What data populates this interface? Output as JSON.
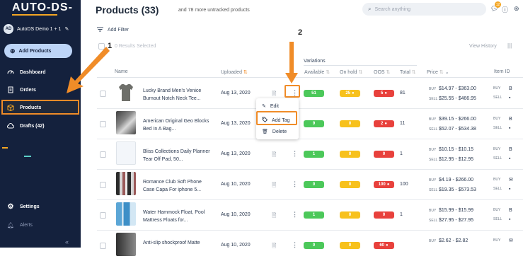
{
  "app": {
    "logo": "AUTO-DS-"
  },
  "sidebar": {
    "account_initials": "AD",
    "account_name": "AutoDS Demo 1 + 1",
    "add_products": "Add Products",
    "items": [
      {
        "label": "Dashboard",
        "icon": "speedometer-icon"
      },
      {
        "label": "Orders",
        "icon": "clipboard-icon"
      },
      {
        "label": "Products",
        "icon": "box-icon"
      },
      {
        "label": "Drafts (42)",
        "icon": "cloud-icon"
      },
      {
        "label": "Settings",
        "icon": "gear-icon"
      },
      {
        "label": "Alerts",
        "icon": "bell-icon"
      }
    ]
  },
  "header": {
    "title": "Products (33)",
    "subtitle": "and 78 more untracked products",
    "search_placeholder": "Search anything",
    "notification_count": "12"
  },
  "toolbar": {
    "add_filter": "Add Filter",
    "selected": "0 Results Selected",
    "view_history": "View History"
  },
  "table": {
    "group_label": "Variations",
    "headers": {
      "name": "Name",
      "uploaded": "Uploaded",
      "available": "Available",
      "on_hold": "On hold",
      "oos": "OOS",
      "total": "Total",
      "price": "Price",
      "item_id": "Item ID"
    },
    "rows": [
      {
        "name": "Lucky Brand Men's Venice Burnout Notch Neck Tee...",
        "date": "Aug 13, 2020",
        "available": "51",
        "on_hold": "25",
        "oos": "5",
        "total": "81",
        "buy": "$14.97 - $363.00",
        "sell": "$25.55 - $466.95",
        "buy_lbl": "BUY",
        "sell_lbl": "SELL",
        "id_icon1": "B",
        "id_icon2": "▪"
      },
      {
        "name": "American Original Geo Blocks Bed In A Bag...",
        "date": "Aug 13, 2020",
        "available": "9",
        "on_hold": "0",
        "oos": "2",
        "total": "11",
        "buy": "$39.15 - $266.00",
        "sell": "$52.07 - $534.38",
        "buy_lbl": "BUY",
        "sell_lbl": "SELL",
        "id_icon1": "B",
        "id_icon2": "▪"
      },
      {
        "name": "Bliss Collections Daily Planner Tear Off Pad, 50...",
        "date": "Aug 13, 2020",
        "available": "1",
        "on_hold": "0",
        "oos": "0",
        "total": "1",
        "buy": "$10.15 - $10.15",
        "sell": "$12.95 - $12.95",
        "buy_lbl": "BUY",
        "sell_lbl": "SELL",
        "id_icon1": "B",
        "id_icon2": "▪"
      },
      {
        "name": "Romance Club Soft Phone Case Capa For iphone 5...",
        "date": "Aug 10, 2020",
        "available": "0",
        "on_hold": "0",
        "oos": "100",
        "total": "100",
        "buy": "$4.19 - $266.00",
        "sell": "$19.35 - $573.53",
        "buy_lbl": "BUY",
        "sell_lbl": "SELL",
        "id_icon1": "✉",
        "id_icon2": "▪"
      },
      {
        "name": "Water Hammock Float, Pool Mattress Floats for...",
        "date": "Aug 10, 2020",
        "available": "1",
        "on_hold": "0",
        "oos": "0",
        "total": "1",
        "buy": "$15.99 - $15.99",
        "sell": "$27.95 - $27.95",
        "buy_lbl": "BUY",
        "sell_lbl": "SELL",
        "id_icon1": "B",
        "id_icon2": "▪"
      },
      {
        "name": "Anti-slip shockproof Matte",
        "date": "Aug 10, 2020",
        "available": "0",
        "on_hold": "0",
        "oos": "60",
        "total": "",
        "buy": "$2.62 - $2.82",
        "sell": "",
        "buy_lbl": "BUY",
        "sell_lbl": "",
        "id_icon1": "✉",
        "id_icon2": ""
      }
    ]
  },
  "row_menu": {
    "edit": "Edit",
    "add_tag": "Add Tag",
    "delete": "Delete"
  },
  "annotations": {
    "step1": "1",
    "step2": "2",
    "arrow_color": "#f08c28"
  }
}
